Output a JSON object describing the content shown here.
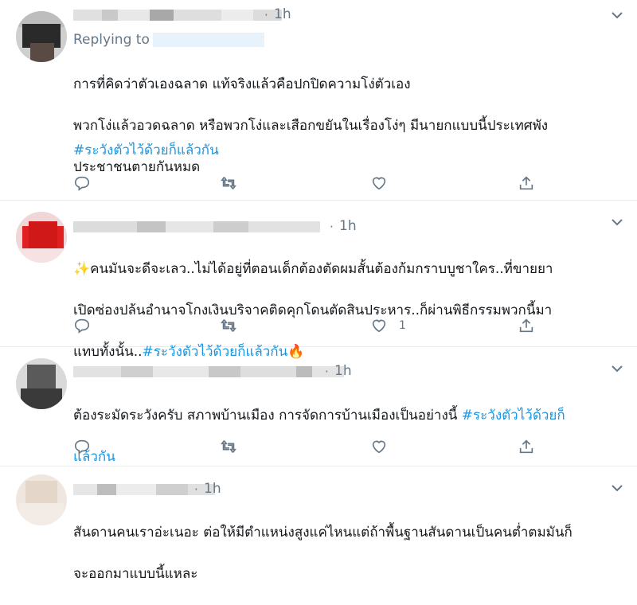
{
  "tweets": [
    {
      "time": "1h",
      "replying_label": "Replying to",
      "lines": [
        "การที่คิดว่าตัวเองฉลาด แท้จริงแล้วคือปกปิดความโง่ตัวเอง",
        "พวกโง่แล้วอวดฉลาด หรือพวกโง่และเสือกขยันในเรื่องโง่ๆ มีนายกแบบนี้ประเทศพัง",
        "ประชาชนตายกันหมด"
      ],
      "hashtag": "#ระวังตัวไว้ด้วยก็แล้วกัน",
      "like_count": ""
    },
    {
      "time": "1h",
      "lead_emoji": "✨",
      "line1": "คนมันจะดีจะเลว..ไม่ได้อยู่ที่ตอนเด็กต้องตัดผมสั้นต้องก้มกราบบูชาใคร..ที่ขายยา",
      "line2": "เปิดซ่องปล้นอำนาจโกงเงินบริจาคติดคุกโดนตัดสินประหาร..ก็ผ่านพิธีกรรมพวกนี้มา",
      "line3_prefix": "แทบทั้งนั้น..",
      "hashtag": "#ระวังตัวไว้ด้วยก็แล้วกัน",
      "trail_emoji": "🔥",
      "like_count": "1"
    },
    {
      "time": "1h",
      "line1_prefix": "ต้องระมัดระวังครับ สภาพบ้านเมือง การจัดการบ้านเมืองเป็นอย่างนี้ ",
      "hashtag_part1": "#ระวังตัวไว้ด้วยก็",
      "hashtag_part2": "แล้วกัน",
      "like_count": ""
    },
    {
      "time": "1h",
      "line1": "สันดานคนเราอ่ะเนอะ ต่อให้มีตำแหน่งสูงแค่ไหนแต่ถ้าพื้นฐานสันดานเป็นคนต่ำตมมันก็",
      "line2": "จะออกมาแบบนี้แหละ"
    }
  ],
  "colors": {
    "hashtag": "#1b95e0",
    "muted": "#657786",
    "divider": "#e6ecf0"
  },
  "icons": [
    "reply-icon",
    "retweet-icon",
    "like-icon",
    "share-icon",
    "chevron-down-icon"
  ]
}
